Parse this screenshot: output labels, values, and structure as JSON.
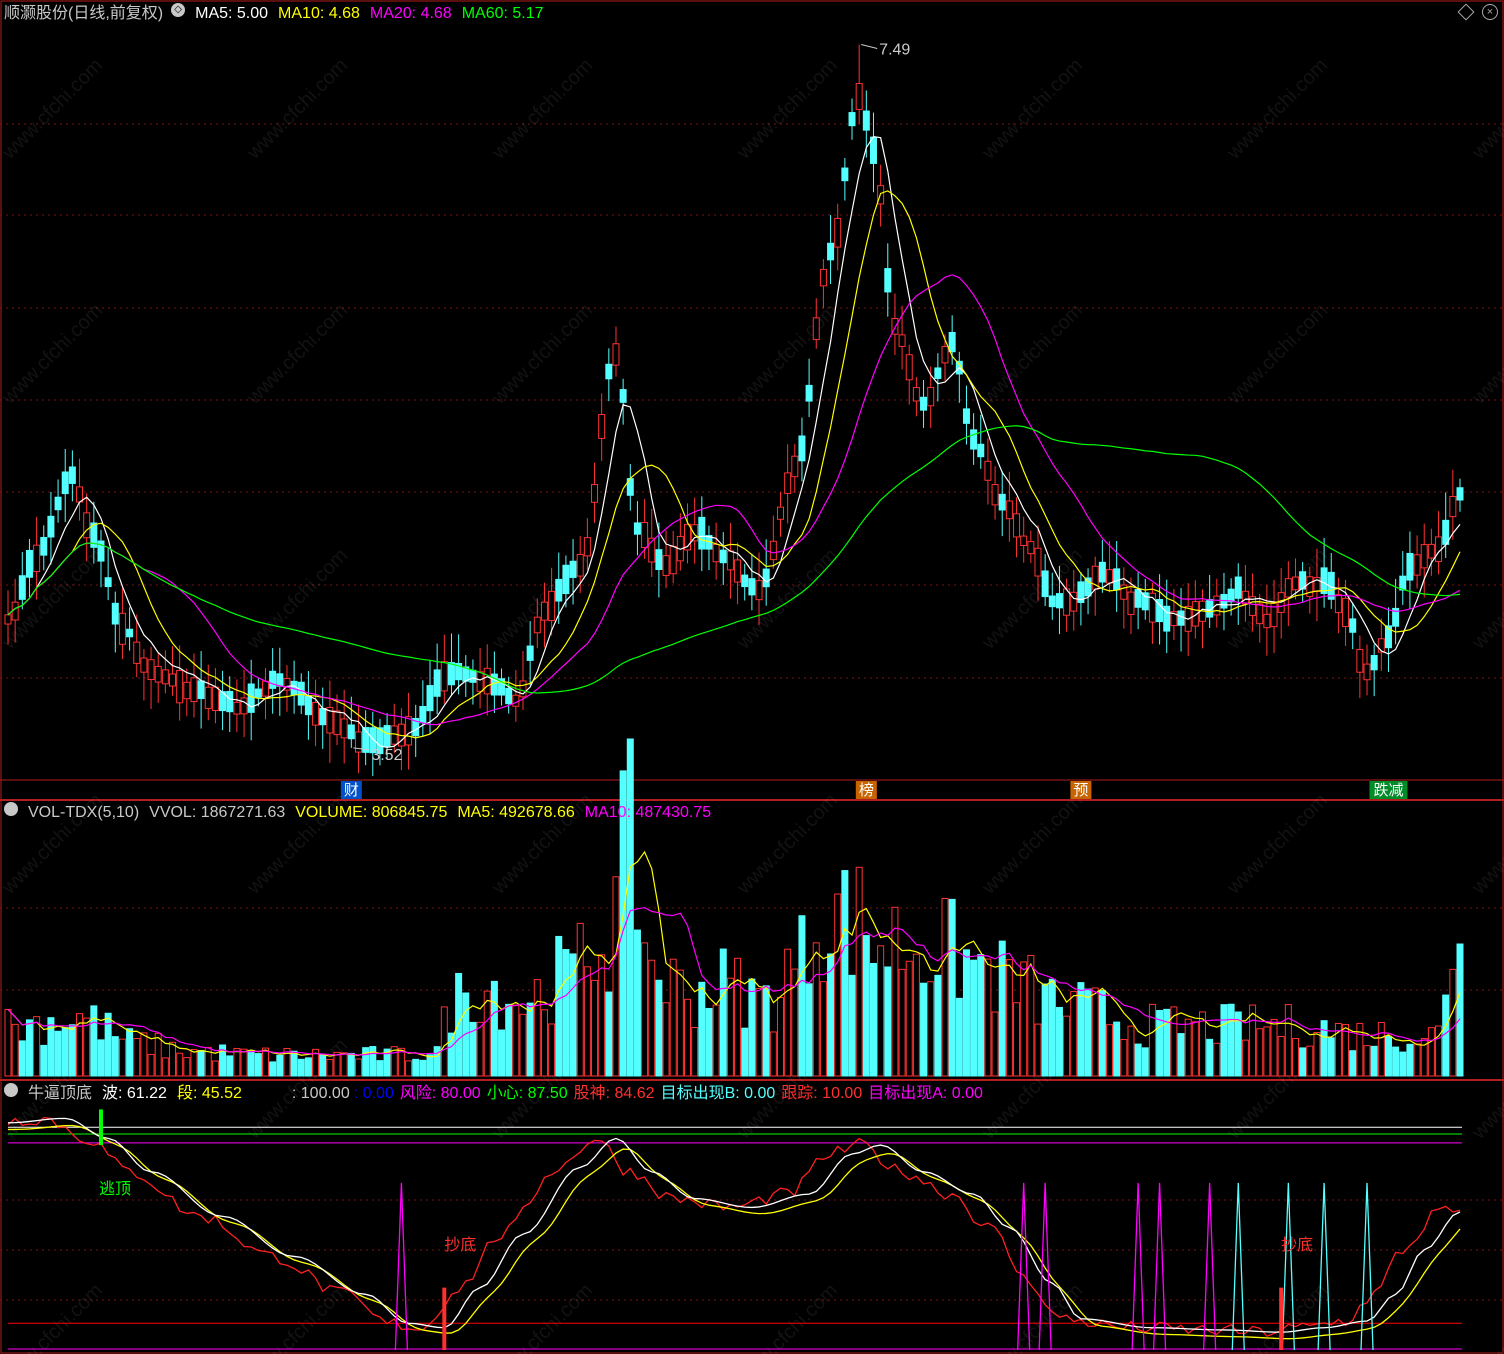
{
  "header1": {
    "title": "顺灏股份(日线,前复权)",
    "ma5": "MA5: 5.00",
    "ma10": "MA10: 4.68",
    "ma20": "MA20: 4.68",
    "ma60": "MA60: 5.17"
  },
  "header2": {
    "name": "VOL-TDX(5,10)",
    "vvol": "VVOL: 1867271.63",
    "volume": "VOLUME: 806845.75",
    "ma5": "MA5: 492678.66",
    "ma10": "MA10: 487430.75"
  },
  "header3": {
    "name": "牛逼顶底",
    "bo": "波: 61.22",
    "duan": "段: 45.52",
    "h100": ": 100.00",
    "zero": ": 0.00",
    "risk": "风险: 80.00",
    "careful": "小心: 87.50",
    "god": "股神: 84.62",
    "targetB": "目标出现B: 0.00",
    "track": "跟踪: 10.00",
    "targetA": "目标出现A: 0.00"
  },
  "annotations": {
    "high": "7.49",
    "low": "3.52",
    "events": [
      {
        "text": "财",
        "bar": 48,
        "color": "#0050c8"
      },
      {
        "text": "榜",
        "bar": 120,
        "color": "#c86400"
      },
      {
        "text": "预",
        "bar": 150,
        "color": "#c86400"
      },
      {
        "text": "跌减",
        "bar": 193,
        "color": "#008c28"
      }
    ],
    "signals": [
      {
        "text": "逃顶",
        "bar": 13,
        "color": "#00ff00"
      },
      {
        "text": "抄底",
        "bar": 61,
        "color": "#ff3030"
      },
      {
        "text": "抄底",
        "bar": 178,
        "color": "#ff3030"
      }
    ]
  },
  "watermark": "www.cfchi.com",
  "colors": {
    "up": "#ff3232",
    "down": "#54ffff",
    "ma5": "#ffffff",
    "ma10": "#ffff00",
    "ma20": "#ff00ff",
    "ma60": "#00ff00",
    "frame": "#b41e1e",
    "grid": "#781414"
  },
  "chart_data": {
    "type": "candlestick",
    "title": "顺灏股份(日线,前复权)",
    "bars": 204,
    "price_anchors": [
      [
        0,
        4.25
      ],
      [
        4,
        4.6
      ],
      [
        9,
        5.05
      ],
      [
        12,
        4.7
      ],
      [
        16,
        4.2
      ],
      [
        20,
        3.95
      ],
      [
        26,
        3.85
      ],
      [
        32,
        3.75
      ],
      [
        38,
        3.9
      ],
      [
        45,
        3.68
      ],
      [
        50,
        3.55
      ],
      [
        56,
        3.62
      ],
      [
        62,
        3.95
      ],
      [
        67,
        3.9
      ],
      [
        71,
        3.8
      ],
      [
        75,
        4.3
      ],
      [
        80,
        4.55
      ],
      [
        85,
        5.75
      ],
      [
        88,
        4.75
      ],
      [
        92,
        4.55
      ],
      [
        96,
        4.75
      ],
      [
        100,
        4.6
      ],
      [
        105,
        4.4
      ],
      [
        110,
        5.1
      ],
      [
        115,
        6.3
      ],
      [
        119,
        7.2
      ],
      [
        121,
        6.9
      ],
      [
        124,
        5.9
      ],
      [
        128,
        5.45
      ],
      [
        132,
        5.8
      ],
      [
        135,
        5.25
      ],
      [
        139,
        4.9
      ],
      [
        143,
        4.65
      ],
      [
        146,
        4.35
      ],
      [
        149,
        4.35
      ],
      [
        153,
        4.5
      ],
      [
        158,
        4.35
      ],
      [
        163,
        4.25
      ],
      [
        168,
        4.3
      ],
      [
        172,
        4.4
      ],
      [
        176,
        4.25
      ],
      [
        180,
        4.45
      ],
      [
        184,
        4.45
      ],
      [
        187,
        4.3
      ],
      [
        190,
        3.95
      ],
      [
        193,
        4.15
      ],
      [
        196,
        4.55
      ],
      [
        200,
        4.65
      ],
      [
        203,
        4.95
      ]
    ],
    "volume_anchors": [
      [
        0,
        0.06
      ],
      [
        10,
        0.07
      ],
      [
        18,
        0.04
      ],
      [
        25,
        0.03
      ],
      [
        35,
        0.025
      ],
      [
        45,
        0.025
      ],
      [
        55,
        0.025
      ],
      [
        60,
        0.03
      ],
      [
        62,
        0.09
      ],
      [
        66,
        0.11
      ],
      [
        72,
        0.09
      ],
      [
        78,
        0.12
      ],
      [
        84,
        0.17
      ],
      [
        87,
        0.28
      ],
      [
        90,
        0.13
      ],
      [
        95,
        0.1
      ],
      [
        100,
        0.11
      ],
      [
        106,
        0.09
      ],
      [
        110,
        0.13
      ],
      [
        114,
        0.2
      ],
      [
        118,
        0.19
      ],
      [
        122,
        0.16
      ],
      [
        127,
        0.16
      ],
      [
        131,
        0.15
      ],
      [
        136,
        0.13
      ],
      [
        141,
        0.11
      ],
      [
        146,
        0.09
      ],
      [
        150,
        0.08
      ],
      [
        160,
        0.06
      ],
      [
        170,
        0.06
      ],
      [
        180,
        0.06
      ],
      [
        190,
        0.05
      ],
      [
        200,
        0.05
      ],
      [
        203,
        0.2
      ]
    ],
    "indicator_anchors": [
      [
        0,
        102
      ],
      [
        8,
        104
      ],
      [
        14,
        95
      ],
      [
        20,
        80
      ],
      [
        30,
        60
      ],
      [
        40,
        42
      ],
      [
        50,
        25
      ],
      [
        56,
        12
      ],
      [
        61,
        10
      ],
      [
        66,
        28
      ],
      [
        72,
        52
      ],
      [
        80,
        82
      ],
      [
        85,
        95
      ],
      [
        90,
        80
      ],
      [
        96,
        68
      ],
      [
        104,
        64
      ],
      [
        112,
        70
      ],
      [
        118,
        88
      ],
      [
        122,
        92
      ],
      [
        128,
        80
      ],
      [
        135,
        70
      ],
      [
        140,
        55
      ],
      [
        146,
        30
      ],
      [
        150,
        14
      ],
      [
        160,
        10
      ],
      [
        170,
        9
      ],
      [
        178,
        8
      ],
      [
        184,
        10
      ],
      [
        190,
        13
      ],
      [
        194,
        25
      ],
      [
        198,
        45
      ],
      [
        203,
        62
      ]
    ],
    "indicator_range": [
      0,
      110
    ],
    "price_range": [
      3.35,
      7.6
    ],
    "indicator_levels": {
      "white": 100,
      "green": 97,
      "magenta": 93,
      "red": 12
    }
  }
}
